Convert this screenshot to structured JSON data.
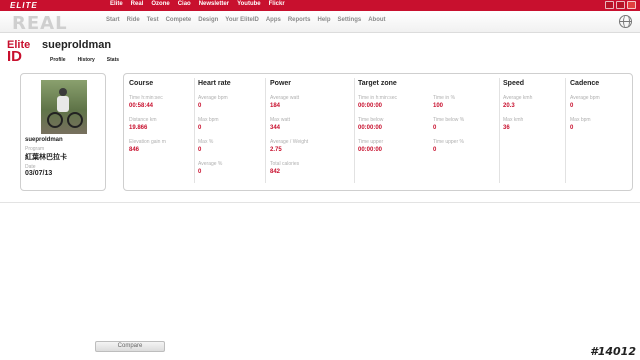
{
  "topbar": {
    "logo": "ELITE",
    "links": [
      "Elite",
      "Real",
      "Ozone",
      "Ciao",
      "Newsletter",
      "Youtube",
      "Flickr"
    ]
  },
  "navbar": {
    "brand": "REAL",
    "menu": [
      "Start",
      "Ride",
      "Test",
      "Compete",
      "Design",
      "Your EliteID",
      "Apps",
      "Reports",
      "Help",
      "Settings",
      "About"
    ]
  },
  "eliteid": {
    "line1": "Elite",
    "line2": "ID"
  },
  "page": {
    "username": "sueproldman",
    "subtabs": [
      "Profile",
      "History",
      "Stats"
    ]
  },
  "profile_card": {
    "name": "sueproldman",
    "program_label": "Program",
    "program_value": "紅葉林巴拉卡",
    "date_label": "Date",
    "date_value": "03/07/13"
  },
  "stats": {
    "course": {
      "title": "Course",
      "items": [
        {
          "label": "Time h:min:sec",
          "value": "00:58:44"
        },
        {
          "label": "Distance km",
          "value": "19.866"
        },
        {
          "label": "Elevation gain m",
          "value": "846"
        }
      ]
    },
    "heart_rate": {
      "title": "Heart rate",
      "items": [
        {
          "label": "Average bpm",
          "value": "0"
        },
        {
          "label": "Max bpm",
          "value": "0"
        },
        {
          "label": "Max %",
          "value": "0"
        },
        {
          "label": "Average %",
          "value": "0"
        }
      ]
    },
    "power": {
      "title": "Power",
      "items": [
        {
          "label": "Average watt",
          "value": "184"
        },
        {
          "label": "Max watt",
          "value": "344"
        },
        {
          "label": "Average / Weight",
          "value": "2.75"
        },
        {
          "label": "Total calories",
          "value": "842"
        }
      ]
    },
    "target_zone": {
      "title": "Target zone",
      "left": [
        {
          "label": "Time in h:min:sec",
          "value": "00:00:00"
        },
        {
          "label": "Time below",
          "value": "00:00:00"
        },
        {
          "label": "Time upper",
          "value": "00:00:00"
        }
      ],
      "right": [
        {
          "label": "Time in %",
          "value": "100"
        },
        {
          "label": "Time below %",
          "value": "0"
        },
        {
          "label": "Time upper %",
          "value": "0"
        }
      ]
    },
    "speed": {
      "title": "Speed",
      "items": [
        {
          "label": "Average kmh",
          "value": "20.3"
        },
        {
          "label": "Max kmh",
          "value": "36"
        }
      ]
    },
    "cadence": {
      "title": "Cadence",
      "items": [
        {
          "label": "Average bpm",
          "value": "0"
        },
        {
          "label": "Max bpm",
          "value": "0"
        }
      ]
    }
  },
  "compare_button": "Compare",
  "watermark": "#14012",
  "colors": {
    "brand_red": "#c8102e",
    "value_red": "#c8102e",
    "label_gray": "#b0b0b0"
  }
}
